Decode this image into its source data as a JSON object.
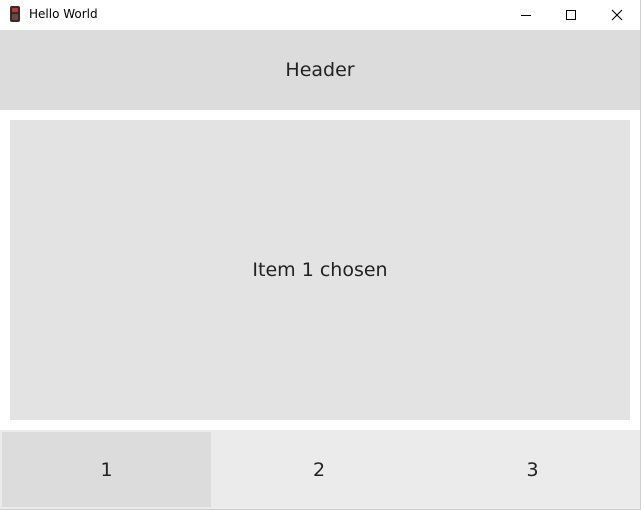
{
  "window": {
    "title": "Hello World",
    "icon": "app-icon",
    "controls": {
      "minimize_icon": "minimize-icon",
      "maximize_icon": "maximize-icon",
      "close_icon": "close-icon",
      "close_glyph": "✕"
    }
  },
  "header": {
    "title": "Header"
  },
  "content": {
    "text": "Item 1 chosen"
  },
  "tabs": [
    {
      "label": "1",
      "selected": true
    },
    {
      "label": "2",
      "selected": false
    },
    {
      "label": "3",
      "selected": false
    }
  ],
  "colors": {
    "header_bg": "#dcdcdc",
    "content_bg": "#e3e3e3",
    "tabbar_bg": "#ebebeb",
    "selected_tab_bg": "#dcdcdc"
  }
}
